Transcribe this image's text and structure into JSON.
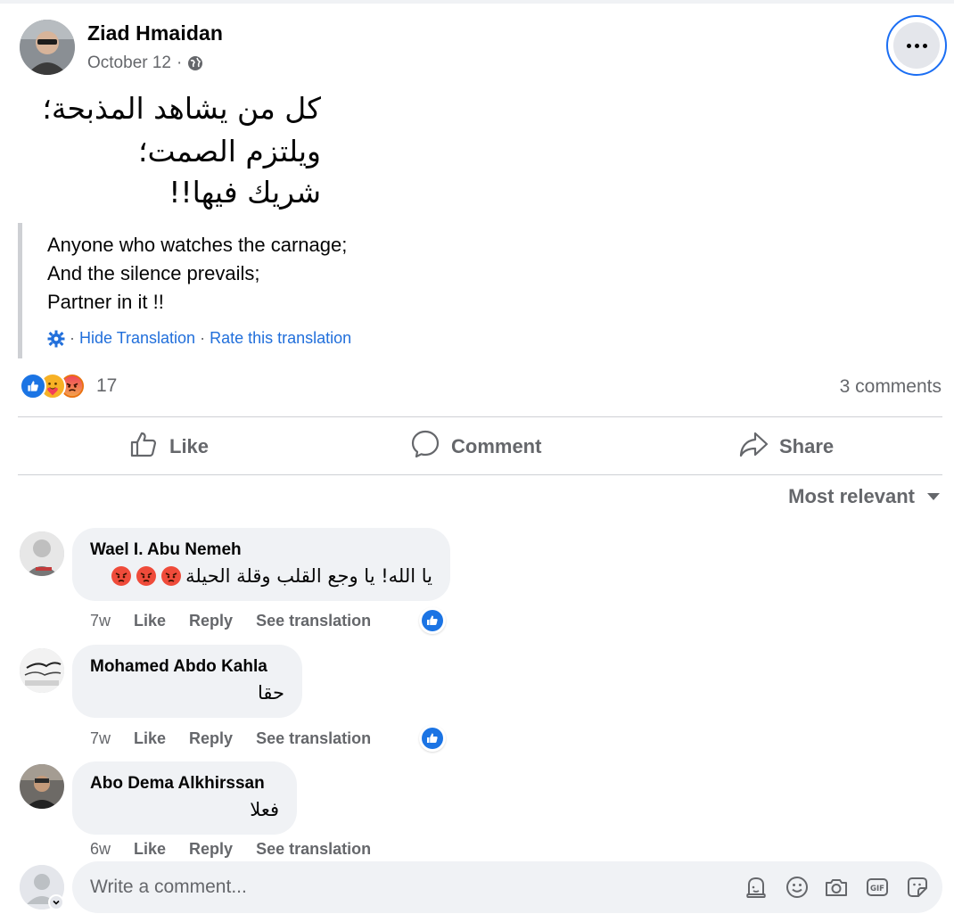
{
  "post": {
    "author": "Ziad Hmaidan",
    "date": "October 12",
    "date_sep": "·",
    "arabic_lines": [
      "كل من يشاهد المذبحة؛",
      "ويلتزم الصمت؛",
      "شريك فيها!!"
    ],
    "translation_lines": [
      "Anyone who watches the carnage;",
      "And the silence prevails;",
      "Partner in it !!"
    ],
    "hide_translation": "Hide Translation",
    "rate_translation": "Rate this translation",
    "action_sep": "·",
    "reaction_count": "17",
    "reactions": [
      "like-icon",
      "care-icon",
      "angry-icon"
    ],
    "comments_count": "3 comments"
  },
  "actions": {
    "like": "Like",
    "comment": "Comment",
    "share": "Share"
  },
  "sort_label": "Most relevant",
  "comments": [
    {
      "name": "Wael I. Abu Nemeh",
      "text": "يا الله! يا وجع القلب وقلة الحيلة",
      "emojis": [
        "angry-icon",
        "angry-icon",
        "angry-icon"
      ],
      "age": "7w",
      "like": "Like",
      "reply": "Reply",
      "translate": "See translation",
      "reaction": "like-icon"
    },
    {
      "name": "Mohamed Abdo Kahla",
      "text": "حقا",
      "age": "7w",
      "like": "Like",
      "reply": "Reply",
      "translate": "See translation",
      "reaction": "like-icon"
    },
    {
      "name": "Abo Dema Alkhirssan",
      "text": "فعلا",
      "age": "6w",
      "like": "Like",
      "reply": "Reply",
      "translate": "See translation"
    }
  ],
  "composer": {
    "placeholder": "Write a comment...",
    "tools": [
      "avatar-sticker-icon",
      "emoji-icon",
      "camera-icon",
      "gif-icon",
      "sticker-icon"
    ]
  },
  "colors": {
    "accent": "#216fdb",
    "like_blue": "#1b74e4",
    "muted": "#65676b",
    "bubble": "#f0f2f5",
    "angry": "#e9710f"
  }
}
